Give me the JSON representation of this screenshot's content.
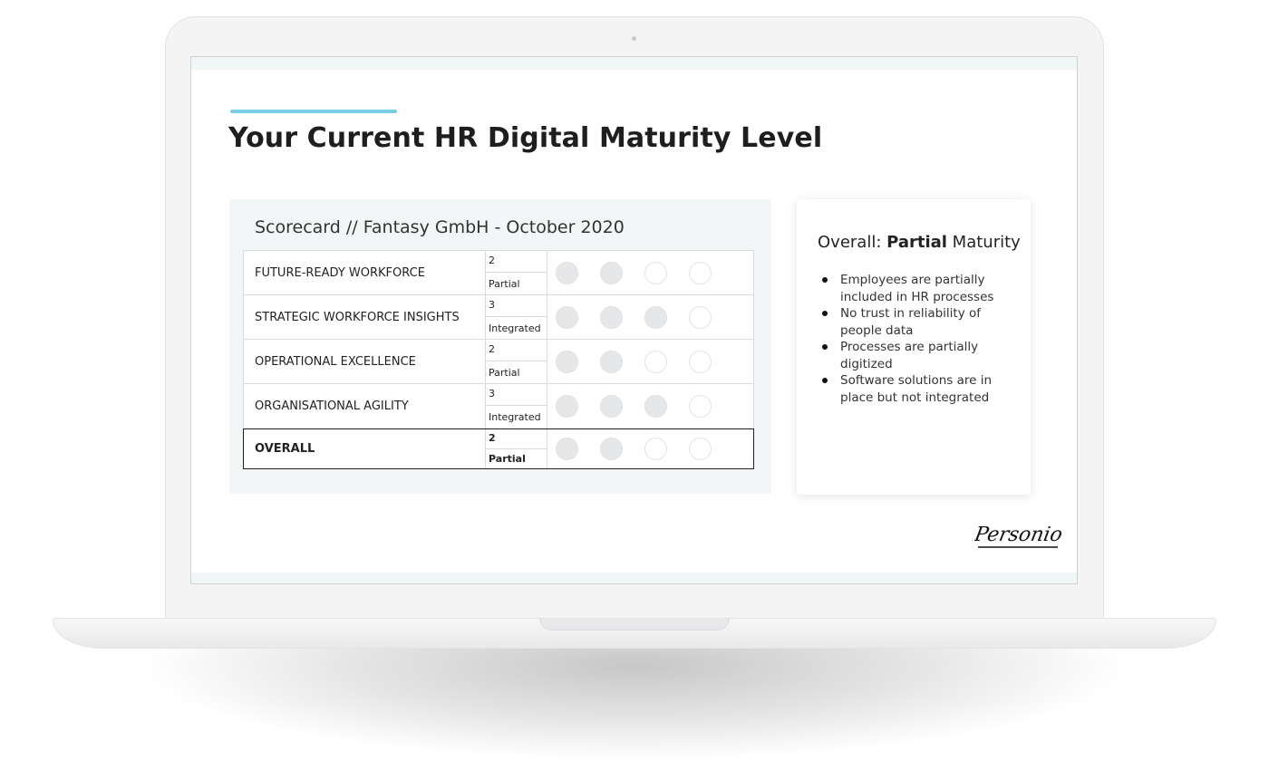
{
  "page_title": "Your Current HR Digital Maturity Level",
  "colors": {
    "accent": "#76cde6",
    "panel_bg": "#f2f6f7",
    "dot_filled": "#e6e7e9"
  },
  "scorecard": {
    "title": "Scorecard // Fantasy GmbH - October 2020",
    "max_level": 4,
    "rows": [
      {
        "name": "FUTURE-READY WORKFORCE",
        "level": "2",
        "label": "Partial",
        "filled": 2
      },
      {
        "name": "STRATEGIC WORKFORCE INSIGHTS",
        "level": "3",
        "label": "Integrated",
        "filled": 3
      },
      {
        "name": "OPERATIONAL EXCELLENCE",
        "level": "2",
        "label": "Partial",
        "filled": 2
      },
      {
        "name": "ORGANISATIONAL AGILITY",
        "level": "3",
        "label": "Integrated",
        "filled": 3
      }
    ],
    "overall": {
      "name": "OVERALL",
      "level": "2",
      "label": "Partial",
      "filled": 2
    }
  },
  "summary": {
    "prefix": "Overall: ",
    "emphasis": "Partial",
    "suffix": " Maturity",
    "bullets": [
      "Employees are partially included in HR processes",
      "No trust in reliability of people data",
      "Processes are partially digitized",
      "Software solutions are in place but not integrated"
    ]
  },
  "logo": {
    "text": "Personio"
  }
}
